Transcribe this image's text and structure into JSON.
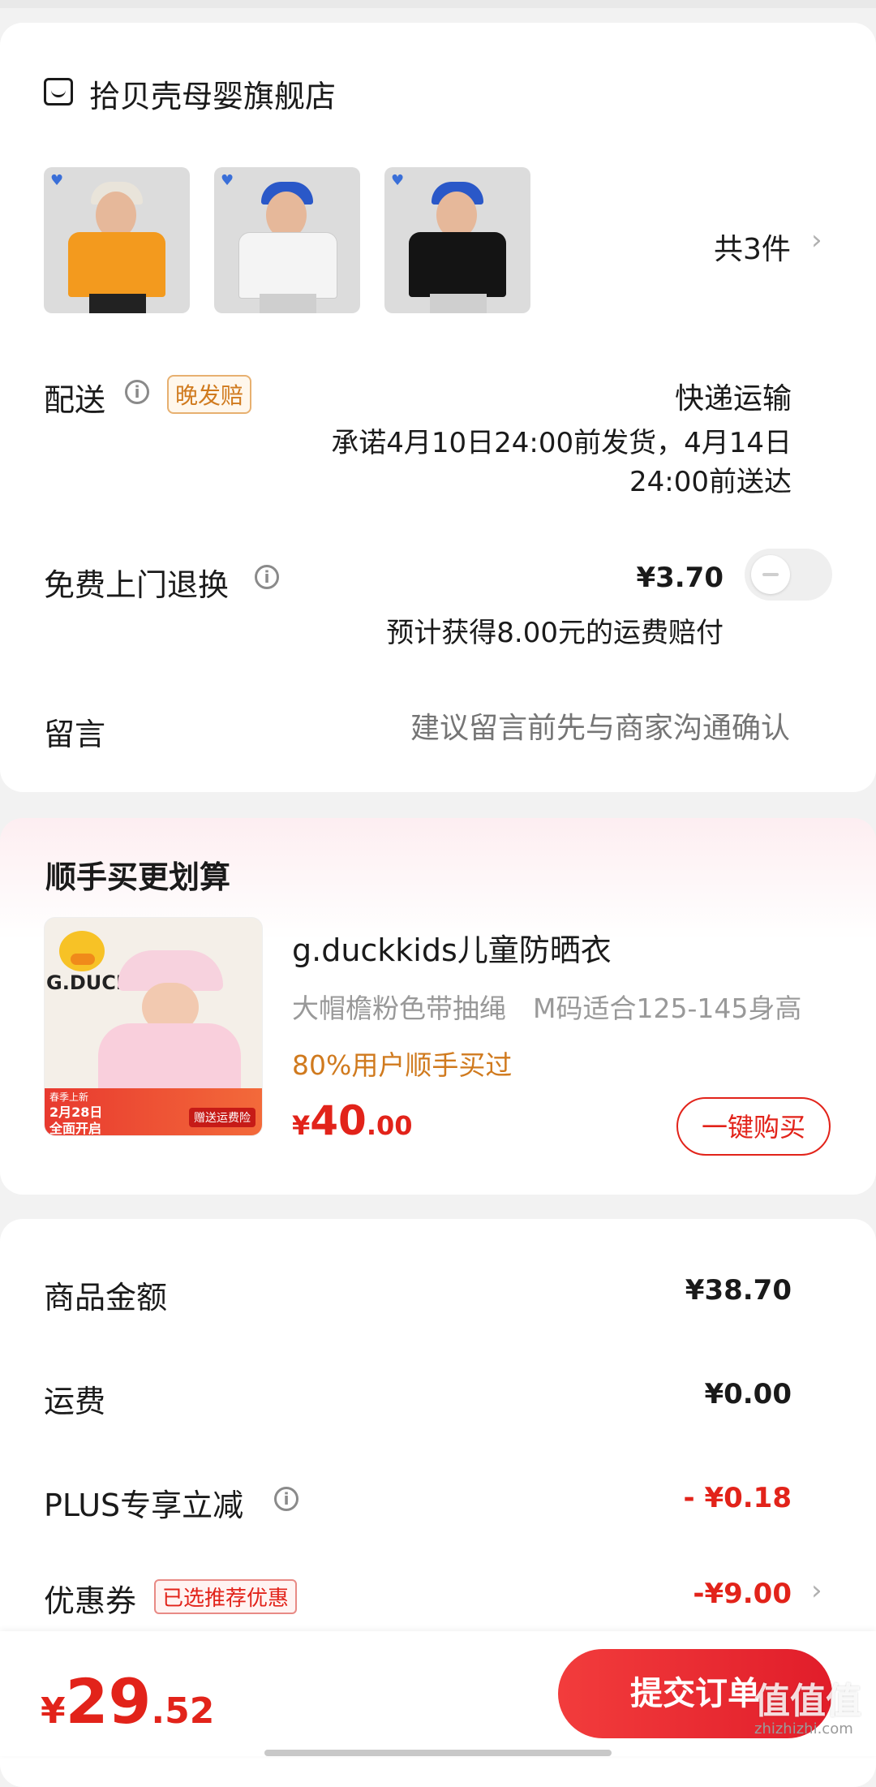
{
  "store": {
    "name": "拾贝壳母婴旗舰店",
    "item_count_label": "共3件",
    "thumbs": [
      {
        "shirt_color": "#f39a1e",
        "cap_color": "#e9e4da",
        "logo": "♥"
      },
      {
        "shirt_color": "#f4f4f4",
        "cap_color": "#2a58c8",
        "logo": "♥"
      },
      {
        "shirt_color": "#141414",
        "cap_color": "#2a58c8",
        "logo": "♥"
      }
    ]
  },
  "delivery": {
    "label": "配送",
    "badge": "晚发赔",
    "method": "快递运输",
    "promise_line1": "承诺4月10日24:00前发货，4月14日",
    "promise_line2": "24:00前送达"
  },
  "return_service": {
    "label": "免费上门退换",
    "price": "¥3.70",
    "note": "预计获得8.00元的运费赔付",
    "enabled": false
  },
  "message": {
    "label": "留言",
    "placeholder": "建议留言前先与商家沟通确认"
  },
  "upsell": {
    "title": "顺手买更划算",
    "product_name": "g.duckkids儿童防晒衣",
    "spec": "大帽檐粉色带抽绳　M码适合125-145身高",
    "social_proof": "80%用户顺手买过",
    "price_symbol": "¥",
    "price_int": "40",
    "price_dec": ".00",
    "buy_button": "一键购买",
    "image_brand": "G.DUCK",
    "image_banner_line1": "春季上新",
    "image_banner_line2": "2月28日",
    "image_banner_line3": "全面开启",
    "image_banner_right": "赠送运费险"
  },
  "summary": {
    "rows": [
      {
        "label": "商品金额",
        "value": "¥38.70",
        "color": "#1a1a1a"
      },
      {
        "label": "运费",
        "value": "¥0.00",
        "color": "#1a1a1a"
      },
      {
        "label": "PLUS专享立减",
        "value": "- ¥0.18",
        "color": "#e2231a"
      },
      {
        "label": "优惠券",
        "value": "-¥9.00",
        "color": "#e2231a"
      }
    ],
    "coupon_badge": "已选推荐优惠"
  },
  "footer": {
    "total_symbol": "¥",
    "total_int": "29",
    "total_dec": ".52",
    "submit_label": "提交订单",
    "watermark": "值值值",
    "watermark_url": "zhizhizhi.com"
  },
  "colors": {
    "accent_red": "#e2231a",
    "orange": "#d07a1e"
  }
}
